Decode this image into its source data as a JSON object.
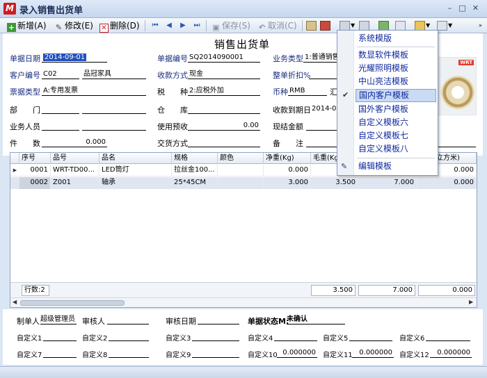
{
  "window": {
    "title": "录入销售出货单",
    "icon_text": "M",
    "controls": [
      "–",
      "□",
      "✕"
    ]
  },
  "toolbar": {
    "add_label": "新增(A)",
    "edit_label": "修改(E)",
    "delete_label": "删除(D)",
    "save_label": "保存(S)",
    "cancel_label": "取消(C)"
  },
  "form": {
    "doc_title": "销售出货单",
    "date_label": "单据日期",
    "date_value": "2014-09-01",
    "docno_label": "单据编号",
    "docno_value": "SQ2014090001",
    "biztype_label": "业务类型",
    "biztype_value": "1:普通销售",
    "customer_label": "客户编号",
    "customer_code": "C02",
    "customer_name": "品冠家具",
    "paymethod_label": "收款方式",
    "paymethod_value": "现金",
    "discount_label": "整单折扣%",
    "discount_value": "",
    "invoicetype_label": "票据类型",
    "invoicetype_value": "A:专用发票",
    "tax_label": "税　　种",
    "tax_value": "2:应税外加",
    "currency_label": "币种",
    "currency_value": "RMB",
    "exrate_label": "汇",
    "dept_label": "部　　门",
    "warehouse_label": "仓　　库",
    "duedate_label": "收款到期日",
    "duedate_value": "2014-09",
    "salesman_label": "业务人员",
    "prepaid_label": "使用预收",
    "prepaid_value": "0.00",
    "cash_label": "现结金额",
    "pieces_label": "件　　数",
    "pieces_value": "0.000",
    "delivery_label": "交货方式",
    "remark_label": "备　　注",
    "photo_logo": "WRT"
  },
  "grid": {
    "columns": [
      "序号",
      "品号",
      "品名",
      "规格",
      "颜色",
      "净重(Kg)",
      "毛重(Kg)",
      "",
      "立方米)"
    ],
    "rows": [
      {
        "seq": "0001",
        "code": "WRT-TD00...",
        "name": "LED筒灯",
        "spec": "拉丝金100...",
        "color": "",
        "net": "0.000",
        "gross": "",
        "c8": "",
        "vol": "0.000"
      },
      {
        "seq": "0002",
        "code": "Z001",
        "name": "轴承",
        "spec": "25*45CM",
        "color": "",
        "net": "3.000",
        "gross": "3.500",
        "c8": "7.000",
        "vol": "0.000"
      }
    ],
    "footer": {
      "rowcount": "行数:2",
      "t_gross": "3.500",
      "t_c8": "7.000",
      "t_vol": "0.000"
    }
  },
  "bottom": {
    "maker_label": "制单人",
    "maker_value": "超级管理员",
    "auditor_label": "审核人",
    "auditdate_label": "审核日期",
    "status_label": "单据状态M:",
    "status_value": "未确认",
    "custom": [
      "自定义1",
      "自定义2",
      "自定义3",
      "自定义4",
      "自定义5",
      "自定义6",
      "自定义7",
      "自定义8",
      "自定义9",
      "自定义10",
      "自定义11",
      "自定义12"
    ],
    "custom_values": [
      "0.000000",
      "0.000000",
      "0.000000"
    ]
  },
  "menu": {
    "header": "系统模版",
    "items": [
      "数显软件模板",
      "光耀照明模板",
      "中山亮洁模板",
      "国内客户模板",
      "国外客户模板",
      "自定义模板六",
      "自定义模板七",
      "自定义模板八"
    ],
    "checked_index": 3,
    "edit": "编辑模板"
  }
}
